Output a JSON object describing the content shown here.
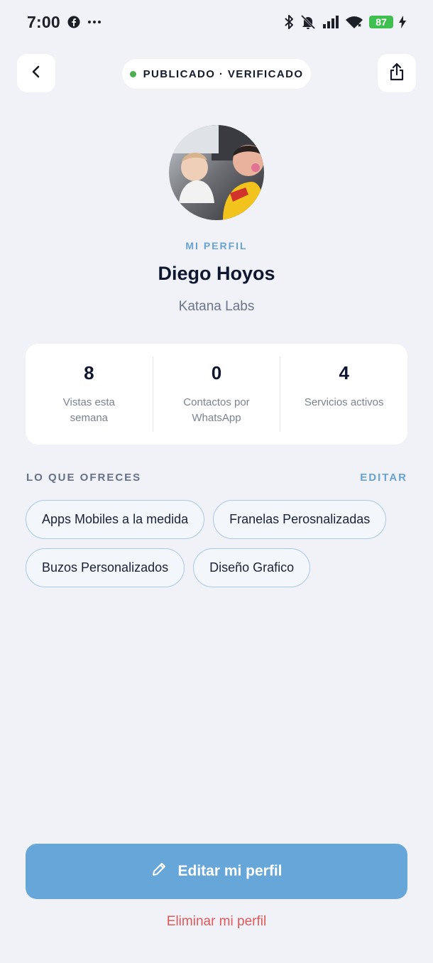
{
  "status_bar": {
    "time": "7:00",
    "notification_icons": [
      "facebook-icon",
      "more-dots-icon"
    ],
    "system_icons": [
      "bluetooth-icon",
      "bell-off-icon",
      "signal-icon",
      "wifi-icon",
      "charging-icon"
    ],
    "battery_level": "87",
    "battery_color": "#3fbf4f"
  },
  "header": {
    "back_icon": "chevron-left-icon",
    "status_label": "PUBLICADO · VERIFICADO",
    "status_dot_color": "#4caf50",
    "share_icon": "share-icon"
  },
  "profile": {
    "eyebrow": "MI PERFIL",
    "name": "Diego Hoyos",
    "company": "Katana Labs"
  },
  "stats": [
    {
      "value": "8",
      "label": "Vistas esta semana"
    },
    {
      "value": "0",
      "label": "Contactos por WhatsApp"
    },
    {
      "value": "4",
      "label": "Servicios activos"
    }
  ],
  "offers": {
    "heading": "LO QUE OFRECES",
    "edit_label": "EDITAR",
    "chips": [
      "Apps Mobiles a la medida",
      "Franelas Perosnalizadas",
      "Buzos Personalizados",
      "Diseño Grafico"
    ]
  },
  "actions": {
    "edit_profile_label": "Editar mi perfil",
    "edit_icon": "pencil-icon",
    "delete_profile_label": "Eliminar mi perfil"
  },
  "colors": {
    "background": "#f0f2f8",
    "accent": "#67a6d8",
    "danger": "#e0585a",
    "chip_border": "#a7c9ea"
  }
}
